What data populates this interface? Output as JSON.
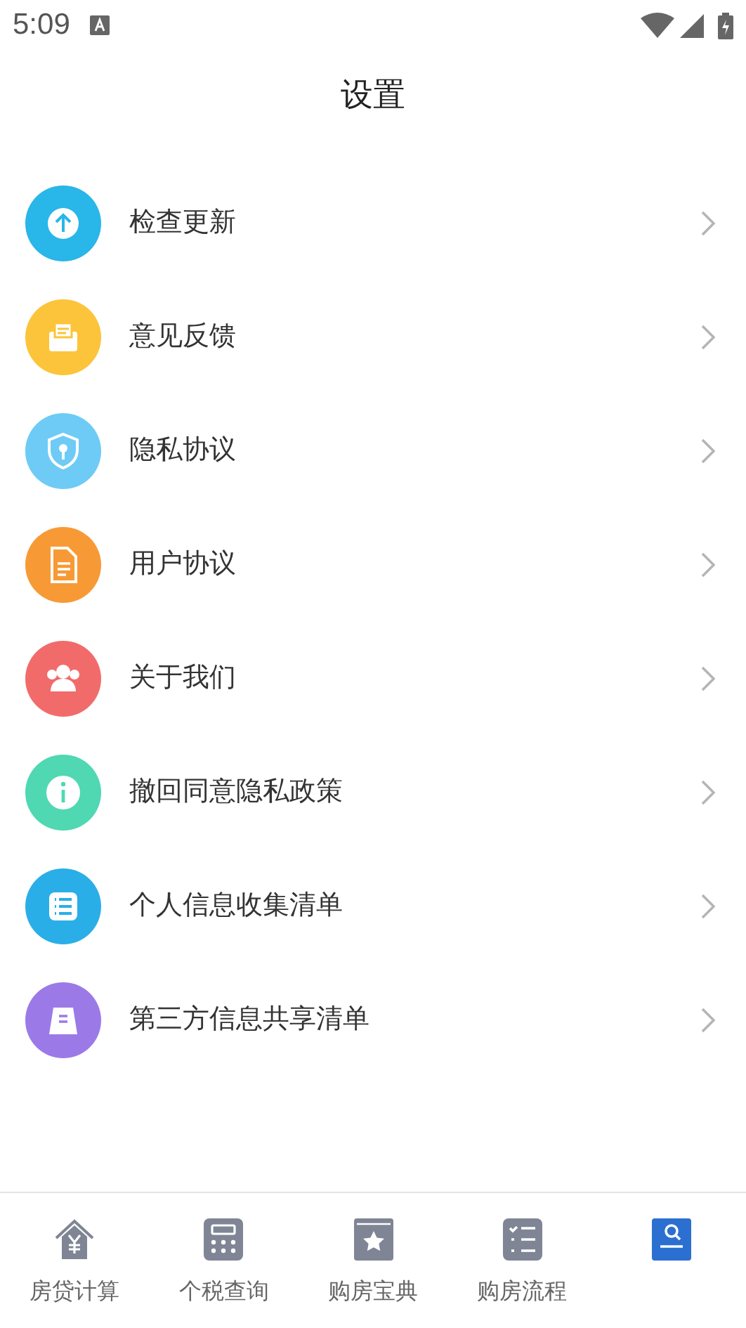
{
  "status_bar": {
    "time": "5:09"
  },
  "title": "设置",
  "items": [
    {
      "label": "检查更新",
      "kind": "update",
      "color": "#29b6e8"
    },
    {
      "label": "意见反馈",
      "kind": "feedback",
      "color": "#fcc43a"
    },
    {
      "label": "隐私协议",
      "kind": "privacy",
      "color": "#6ecbf5"
    },
    {
      "label": "用户协议",
      "kind": "document",
      "color": "#f79a35"
    },
    {
      "label": "关于我们",
      "kind": "about",
      "color": "#f26b6b"
    },
    {
      "label": "撤回同意隐私政策",
      "kind": "info",
      "color": "#4fd8b2"
    },
    {
      "label": "个人信息收集清单",
      "kind": "list",
      "color": "#2aaee8"
    },
    {
      "label": "第三方信息共享清单",
      "kind": "share",
      "color": "#9b7ae8"
    }
  ],
  "tabs": [
    {
      "label": "房贷计算",
      "kind": "house",
      "selected": false
    },
    {
      "label": "个税查询",
      "kind": "calculator",
      "selected": false
    },
    {
      "label": "购房宝典",
      "kind": "book",
      "selected": false
    },
    {
      "label": "购房流程",
      "kind": "checklist",
      "selected": false
    },
    {
      "kind": "search",
      "selected": true
    }
  ]
}
